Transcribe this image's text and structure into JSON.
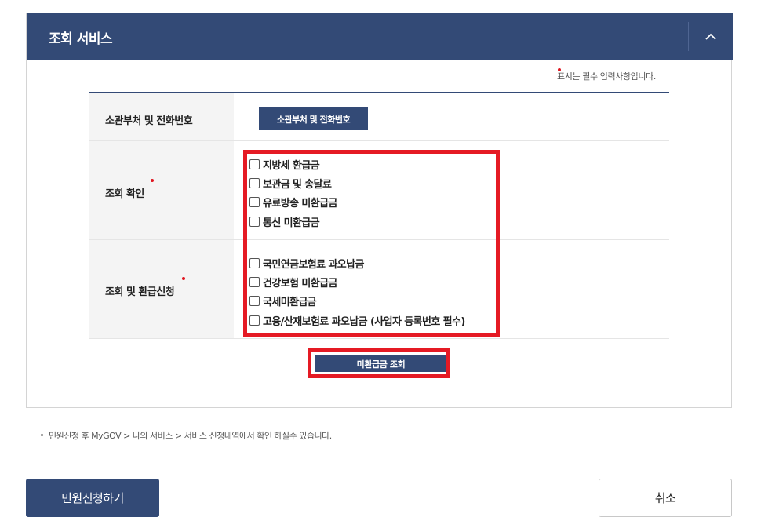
{
  "panel": {
    "title": "조회 서비스",
    "collapse_icon": "chevron-up-icon",
    "required_note": "표시는 필수 입력사항입니다."
  },
  "rows": {
    "dept": {
      "label": "소관부처 및 전화번호",
      "button": "소관부처 및 전화번호"
    },
    "inquiry": {
      "label": "조회 확인",
      "options": [
        "지방세 환급금",
        "보관금 및 송달료",
        "유료방송 미환급금",
        "통신 미환급금"
      ]
    },
    "refund": {
      "label": "조회 및 환급신청",
      "options": [
        "국민연금보험료 과오납금",
        "건강보험 미환급금",
        "국세미환급금",
        "고용/산재보험료 과오납금 (사업자 등록번호 필수)"
      ]
    }
  },
  "search_button": "미환급금 조회",
  "info_note": "민원신청 후 MyGOV > 나의 서비스 > 서비스 신청내역에서 확인 하실수 있습니다.",
  "footer": {
    "apply_button": "민원신청하기",
    "cancel_button": "취소"
  },
  "colors": {
    "primary": "#334a76",
    "required": "#e0151f",
    "highlight": "#e51a24"
  }
}
